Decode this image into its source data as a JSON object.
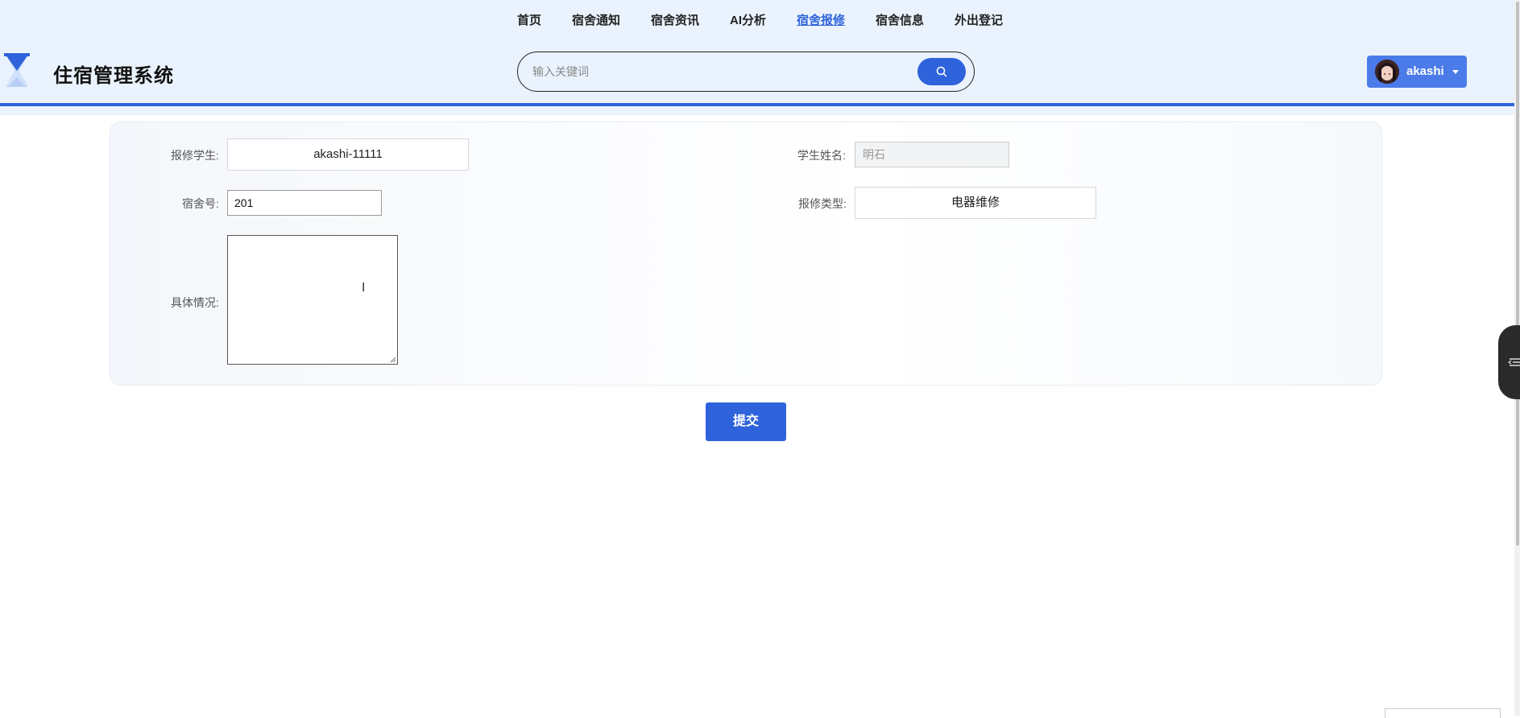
{
  "nav": {
    "items": [
      {
        "label": "首页",
        "active": false
      },
      {
        "label": "宿舍通知",
        "active": false
      },
      {
        "label": "宿舍资讯",
        "active": false
      },
      {
        "label": "AI分析",
        "active": false
      },
      {
        "label": "宿舍报修",
        "active": true
      },
      {
        "label": "宿舍信息",
        "active": false
      },
      {
        "label": "外出登记",
        "active": false
      }
    ]
  },
  "header": {
    "title": "住宿管理系统",
    "logo_icon": "hourglass-icon"
  },
  "search": {
    "placeholder": "输入关键词",
    "value": "",
    "icon": "search-icon"
  },
  "user": {
    "name": "akashi",
    "avatar_icon": "avatar"
  },
  "form": {
    "student_label": "报修学生:",
    "student_value": "akashi-11111",
    "name_label": "学生姓名:",
    "name_value": "明石",
    "dorm_label": "宿舍号:",
    "dorm_value": "201",
    "type_label": "报修类型:",
    "type_value": "电器维修",
    "detail_label": "具体情况:",
    "detail_value": ""
  },
  "submit": {
    "label": "提交"
  },
  "colors": {
    "accent": "#2f63db",
    "header_bg": "#eaf3fd"
  }
}
